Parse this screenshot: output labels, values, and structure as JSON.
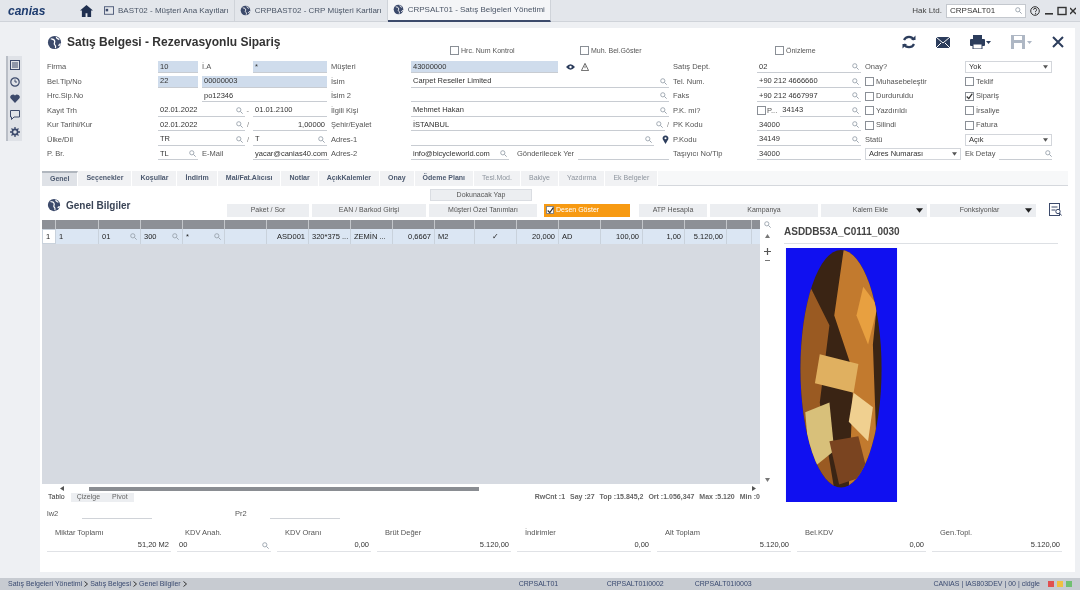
{
  "app": {
    "logo": "canias",
    "company": "Hak Ltd.",
    "program": "CRPSALT01"
  },
  "open_tabs": [
    {
      "label": "BAST02 - Müşteri Ana Kayıtları",
      "kind": "card",
      "selected": false
    },
    {
      "label": "CRPBAST02 - CRP Müşteri Kartları",
      "kind": "globe",
      "selected": false
    },
    {
      "label": "CRPSALT01 - Satış Belgeleri Yönetimi",
      "kind": "globe",
      "selected": true
    }
  ],
  "title": "Satış Belgesi - Rezervasyonlu Sipariş",
  "options": [
    {
      "label": "Hrc. Num Kontrol",
      "checked": false
    },
    {
      "label": "Muh. Bel.Göster",
      "checked": false
    },
    {
      "label": "Önizleme",
      "checked": false
    }
  ],
  "form_rows": [
    [
      {
        "kind": "label",
        "text": "Firma"
      },
      {
        "kind": "field",
        "value": "10",
        "highlighted": true,
        "lookup": false
      },
      {
        "kind": "label",
        "text": "İ.A"
      },
      {
        "kind": "field",
        "value": "*",
        "highlighted": true,
        "lookup": false
      },
      {
        "kind": "label",
        "text": "Müşteri"
      },
      {
        "kind": "field",
        "value": "43000000",
        "highlighted": true,
        "lookup": false
      },
      {
        "kind": "label",
        "text": "Satış Dept."
      },
      {
        "kind": "field",
        "value": "02",
        "highlighted": false,
        "lookup": true
      },
      {
        "kind": "label",
        "text": "Onay?"
      },
      {
        "kind": "select",
        "value": "Yok"
      }
    ],
    [
      {
        "kind": "label",
        "text": "Bel.Tip/No"
      },
      {
        "kind": "field",
        "value": "22",
        "highlighted": true,
        "lookup": false
      },
      {
        "kind": "field",
        "value": "00000003",
        "highlighted": true,
        "lookup": false
      },
      {
        "kind": "label",
        "text": "İsim"
      },
      {
        "kind": "field",
        "value": "Carpet Reseller Limited",
        "highlighted": false,
        "lookup": true
      },
      {
        "kind": "label",
        "text": "Tel. Num."
      },
      {
        "kind": "field",
        "value": "+90 212 4666660",
        "highlighted": false,
        "lookup": true
      },
      {
        "kind": "checkbox",
        "label": "Muhasebeleştir",
        "checked": false
      },
      {
        "kind": "checkbox",
        "label": "Teklif",
        "checked": false
      }
    ],
    [
      {
        "kind": "label",
        "text": "Hrc.Sip.No"
      },
      {
        "kind": "field",
        "value": "po12346",
        "highlighted": false,
        "lookup": false
      },
      {
        "kind": "label",
        "text": "İsim 2"
      },
      {
        "kind": "field",
        "highlighted": false,
        "lookup": true
      },
      {
        "kind": "label",
        "text": "Faks"
      },
      {
        "kind": "field",
        "value": "+90 212 4667997",
        "highlighted": false,
        "lookup": true
      },
      {
        "kind": "checkbox",
        "label": "Durduruldu",
        "checked": false
      },
      {
        "kind": "checkbox",
        "label": "Sipariş",
        "checked": true
      }
    ],
    [
      {
        "kind": "label",
        "text": "Kayıt Trh"
      },
      {
        "kind": "field",
        "value": "02.01.2022",
        "highlighted": false,
        "lookup": true,
        "suffix": "-"
      },
      {
        "kind": "field",
        "value": "01.01.2100",
        "highlighted": false,
        "lookup": false
      },
      {
        "kind": "label",
        "text": "İlgili Kişi"
      },
      {
        "kind": "field",
        "value": "Mehmet Hakan",
        "highlighted": false,
        "lookup": true
      },
      {
        "kind": "label",
        "text": "P.K. mi?"
      },
      {
        "kind": "checkfield",
        "label": "P...",
        "checked": false,
        "value": "34143"
      },
      {
        "kind": "checkbox",
        "label": "Yazdırıldı",
        "checked": false
      },
      {
        "kind": "checkbox",
        "label": "İrsaliye",
        "checked": false
      }
    ],
    [
      {
        "kind": "label",
        "text": "Kur Tarihi/Kur"
      },
      {
        "kind": "field",
        "value": "02.01.2022",
        "highlighted": false,
        "lookup": true,
        "suffix": "/"
      },
      {
        "kind": "field",
        "value": "1,00000",
        "highlighted": false,
        "lookup": false,
        "numeric": true
      },
      {
        "kind": "label",
        "text": "Şehir/Eyalet"
      },
      {
        "kind": "field",
        "value": "İSTANBUL",
        "highlighted": false,
        "lookup": true,
        "suffix": "/"
      },
      {
        "kind": "label",
        "text": "PK Kodu"
      },
      {
        "kind": "field",
        "value": "34000",
        "highlighted": false,
        "lookup": true
      },
      {
        "kind": "checkbox",
        "label": "Silindi",
        "checked": false
      },
      {
        "kind": "checkbox",
        "label": "Fatura",
        "checked": false
      }
    ],
    [
      {
        "kind": "label",
        "text": "Ülke/Dil"
      },
      {
        "kind": "field",
        "value": "TR",
        "highlighted": false,
        "lookup": true,
        "suffix": "/"
      },
      {
        "kind": "field",
        "value": "T",
        "highlighted": false,
        "lookup": true
      },
      {
        "kind": "label",
        "text": "Adres-1"
      },
      {
        "kind": "field",
        "highlighted": false,
        "lookup": true
      },
      {
        "kind": "label",
        "text": "P.Kodu"
      },
      {
        "kind": "field",
        "value": "34149",
        "highlighted": false,
        "lookup": true
      },
      {
        "kind": "label",
        "text": "Statü"
      },
      {
        "kind": "select",
        "value": "Açık"
      }
    ],
    [
      {
        "kind": "label",
        "text": "P. Br."
      },
      {
        "kind": "field",
        "value": "TL",
        "highlighted": false,
        "lookup": true
      },
      {
        "kind": "label",
        "text": "E-Mail"
      },
      {
        "kind": "field",
        "value": "yacar@canias40.com",
        "highlighted": false,
        "lookup": false
      },
      {
        "kind": "label",
        "text": "Adres-2"
      },
      {
        "kind": "field",
        "value": "info@bicycleworld.com",
        "highlighted": false,
        "lookup": true,
        "trailing_label": "Gönderilecek Yer"
      },
      {
        "kind": "label",
        "text": "Taşıyıcı No/Tip"
      },
      {
        "kind": "field",
        "value": "34000",
        "highlighted": false,
        "lookup": false
      },
      {
        "kind": "select",
        "value": "Adres Numarası"
      },
      {
        "kind": "labelfield",
        "label": "Ek Detay"
      }
    ]
  ],
  "tabs": [
    {
      "label": "Genel",
      "selected": true,
      "disabled": false
    },
    {
      "label": "Seçenekler",
      "selected": false,
      "disabled": false
    },
    {
      "label": "Koşullar",
      "selected": false,
      "disabled": false
    },
    {
      "label": "İndirim",
      "selected": false,
      "disabled": false
    },
    {
      "label": "Mal/Fat.Alıcısı",
      "selected": false,
      "disabled": false
    },
    {
      "label": "Notlar",
      "selected": false,
      "disabled": false
    },
    {
      "label": "AçıkKalemler",
      "selected": false,
      "disabled": false
    },
    {
      "label": "Onay",
      "selected": false,
      "disabled": false
    },
    {
      "label": "Ödeme Planı",
      "selected": false,
      "disabled": false
    },
    {
      "label": "Tesl.Mod.",
      "selected": false,
      "disabled": true
    },
    {
      "label": "Bakiye",
      "selected": false,
      "disabled": true
    },
    {
      "label": "Yazdırma",
      "selected": false,
      "disabled": true
    },
    {
      "label": "Ek Belgeler",
      "selected": false,
      "disabled": true
    }
  ],
  "section_title": "Genel Bilgiler",
  "top_action": "Dokunacak Yap",
  "actions": [
    {
      "kind": "plain",
      "label": "Paket / Sor"
    },
    {
      "kind": "plain",
      "label": "EAN / Barkod Girişi"
    },
    {
      "kind": "plain",
      "label": "Müşteri Özel Tanımları"
    },
    {
      "kind": "toggle",
      "label": "Desen Göster",
      "checked": true
    },
    {
      "kind": "plain",
      "label": "ATP Hesapla"
    },
    {
      "kind": "plain",
      "label": "Kampanya"
    },
    {
      "kind": "dropdown",
      "label": "Kalem Ekle"
    },
    {
      "kind": "dropdown",
      "label": "Fonksiyonlar"
    }
  ],
  "table": {
    "rows": [
      {
        "selected": true,
        "cells": [
          "1",
          "1",
          "01",
          "300",
          "*",
          "",
          "ASD001",
          "320*375 ...",
          "ZEMİN ...",
          "0,6667",
          "M2",
          "✓",
          "20,000",
          "AD",
          "100,00",
          "1,00",
          "5.120,00",
          ""
        ]
      }
    ]
  },
  "view_tabs": [
    {
      "label": "Tablo",
      "selected": true
    },
    {
      "label": "Çizelge",
      "selected": false
    },
    {
      "label": "Pivot",
      "selected": false
    }
  ],
  "stats": [
    "RwCnt :1",
    "Say :27",
    "Top :15.845,2",
    "Ort :1.056,347",
    "Max :5.120",
    "Min :0"
  ],
  "image_panel": {
    "title": "ASDDB53A_C0111_0030"
  },
  "extra_fields": [
    {
      "label": "lw2"
    },
    {
      "label": "Pr2"
    }
  ],
  "totals": [
    {
      "label": "Miktar Toplamı",
      "value": "51,20 M2"
    },
    {
      "label": "KDV Anah.",
      "value": "00",
      "lookup": true
    },
    {
      "label": "KDV Oranı",
      "value": "0,00"
    },
    {
      "label": "Brüt Değer",
      "value": "5.120,00"
    },
    {
      "label": "İndirimler",
      "value": "0,00"
    },
    {
      "label": "Alt Toplam",
      "value": "5.120,00"
    },
    {
      "label": "Bel.KDV",
      "value": "0,00"
    },
    {
      "label": "Gen.Topl.",
      "value": "5.120,00"
    }
  ],
  "status_bar": {
    "breadcrumbs": [
      "Satış Belgeleri Yönetimi",
      "Satış Belgesi",
      "Genel Bilgiler"
    ],
    "items": [
      "CRPSALT01",
      "CRPSALT01I0002",
      "CRPSALT01I0003"
    ],
    "info": "CANIAS | IAS803DEV | 00 | cldgle"
  }
}
